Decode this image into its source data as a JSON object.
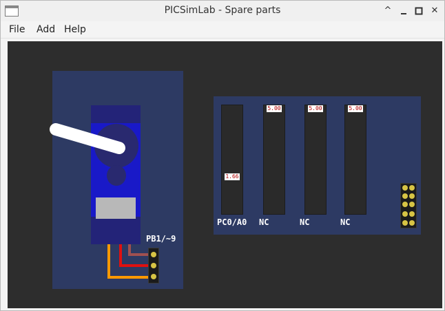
{
  "window": {
    "title": "PICSimLab - Spare parts"
  },
  "titlebar_buttons": [
    "^",
    "✕"
  ],
  "menu": {
    "items": [
      "File",
      "Add",
      "Help"
    ]
  },
  "servo": {
    "pin_label": "PB1/~9"
  },
  "voltmeter": {
    "channels": [
      {
        "label": "PC0/A0",
        "value": "1.66"
      },
      {
        "label": "NC",
        "value": "5.00"
      },
      {
        "label": "NC",
        "value": "5.00"
      },
      {
        "label": "NC",
        "value": "5.00"
      }
    ]
  },
  "colors": {
    "canvas": "#2d2d2d",
    "board": "#2d3a63",
    "servo_body": "#1919c8",
    "pin": "#d7c444",
    "wire_orange": "#ff9900",
    "wire_red": "#e01010",
    "wire_brown": "#a05050"
  }
}
